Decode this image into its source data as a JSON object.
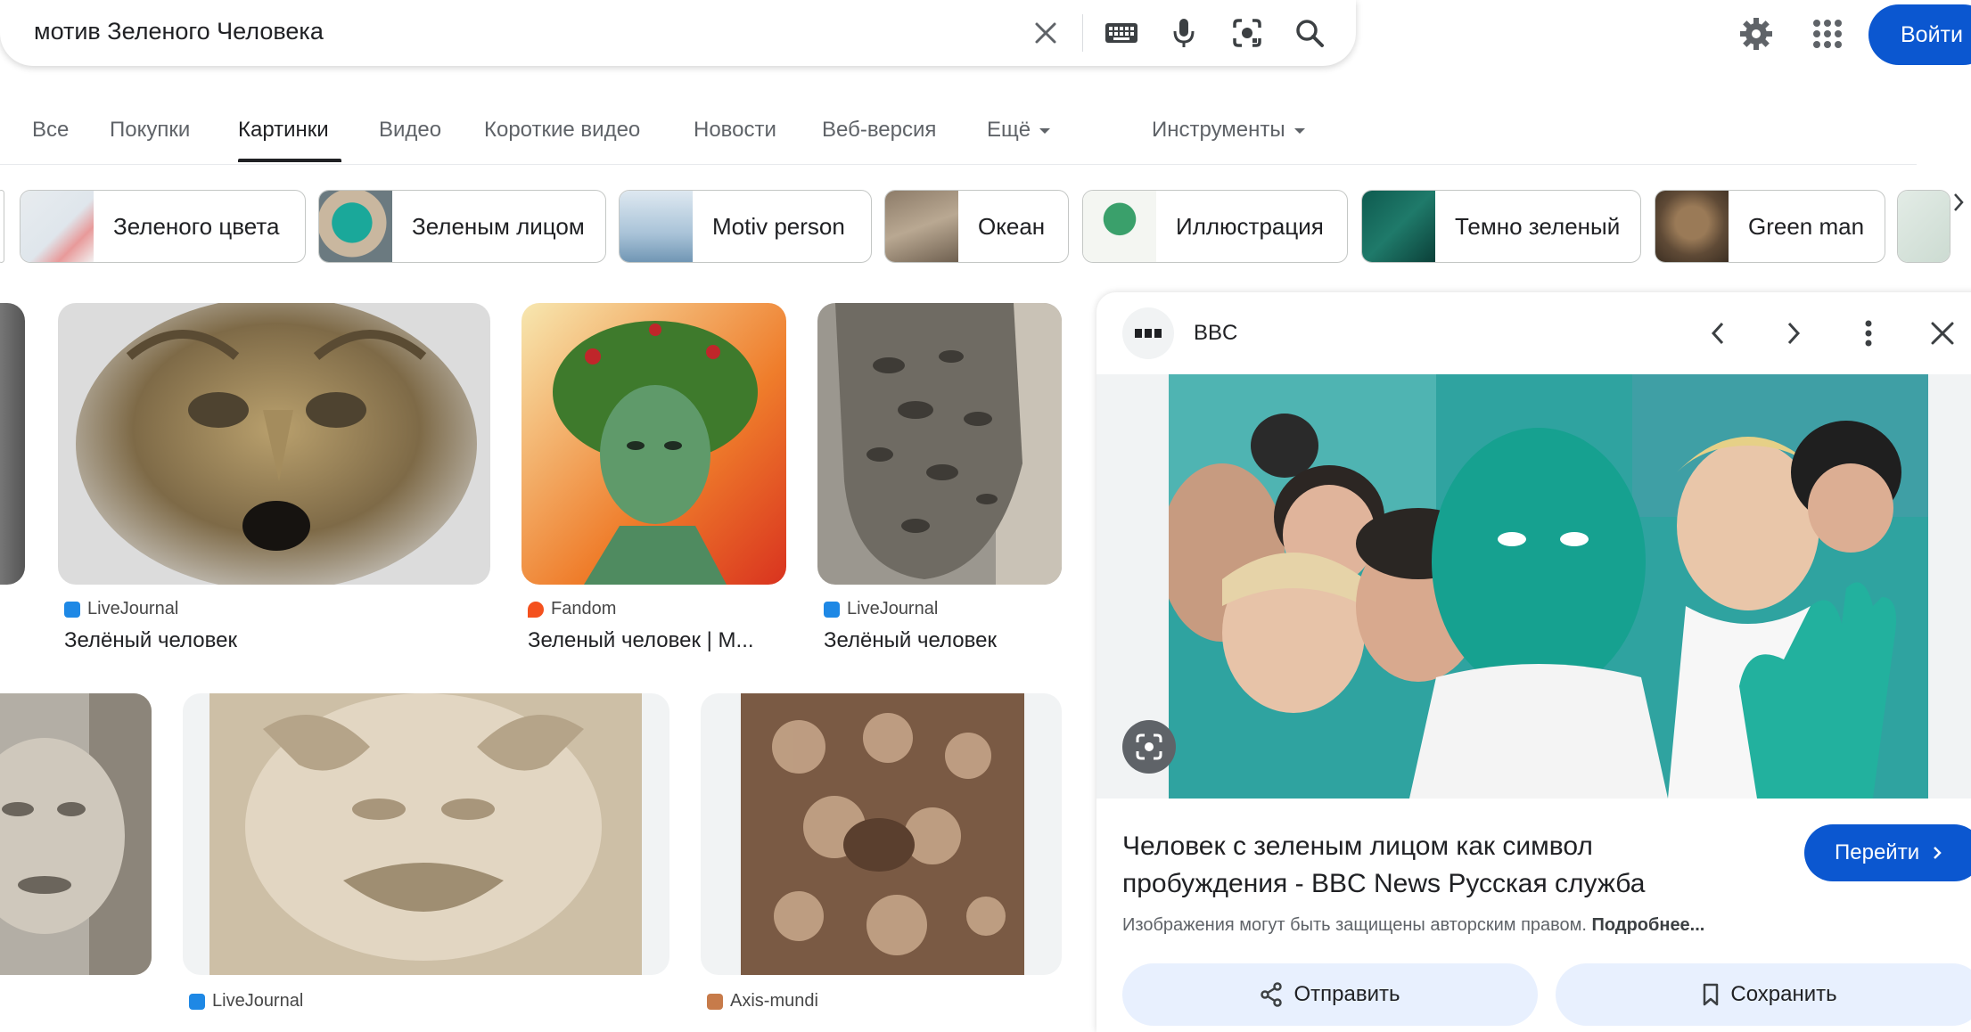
{
  "search": {
    "query": "мотив Зеленого Человека"
  },
  "header": {
    "signin_label": "Войти"
  },
  "tabs": [
    {
      "label": "Все"
    },
    {
      "label": "Покупки"
    },
    {
      "label": "Картинки"
    },
    {
      "label": "Видео"
    },
    {
      "label": "Короткие видео"
    },
    {
      "label": "Новости"
    },
    {
      "label": "Веб-версия"
    },
    {
      "label": "Ещё"
    }
  ],
  "tools_label": "Инструменты",
  "chips": [
    {
      "label": "Зеленого цвета"
    },
    {
      "label": "Зеленым лицом"
    },
    {
      "label": "Motiv person"
    },
    {
      "label": "Океан"
    },
    {
      "label": "Иллюстрация"
    },
    {
      "label": "Темно зеленый"
    },
    {
      "label": "Green man"
    }
  ],
  "results": [
    {
      "source": "LiveJournal",
      "title": "Зелёный человек"
    },
    {
      "source": "Fandom",
      "title": "Зеленый человек | M..."
    },
    {
      "source": "LiveJournal",
      "title": "Зелёный человек"
    },
    {
      "source": "LiveJournal",
      "title": ""
    },
    {
      "source": "Axis-mundi",
      "title": ""
    }
  ],
  "panel": {
    "source": "BBC",
    "title_line1": "Человек с зеленым лицом как символ",
    "title_line2": "пробуждения - BBC News Русская служба",
    "copyright": "Изображения могут быть защищены авторским правом.",
    "more_link": "Подробнее...",
    "visit_label": "Перейти",
    "share_label": "Отправить",
    "save_label": "Сохранить"
  },
  "colors": {
    "accent": "#0b57d0",
    "face_green": "#1aa89a"
  }
}
